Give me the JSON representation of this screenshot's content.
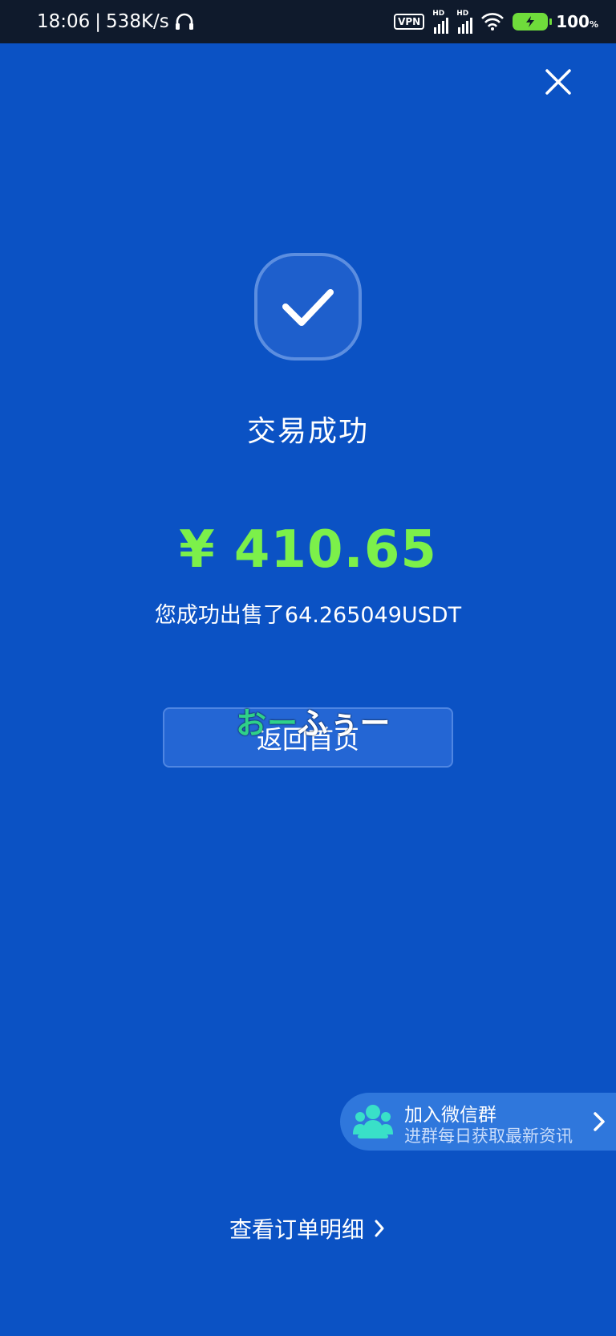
{
  "status_bar": {
    "time": "18:06",
    "separator": "|",
    "speed": "538K/s",
    "vpn": "VPN",
    "hd1": "HD",
    "hd2": "HD",
    "battery_percent": "100",
    "battery_unit": "%"
  },
  "result": {
    "title": "交易成功",
    "amount": "¥ 410.65",
    "description": "您成功出售了64.265049USDT",
    "home_button": "返回首页"
  },
  "overlay_caption": {
    "green_part": "おー",
    "white_part": "ふぅー"
  },
  "wechat_banner": {
    "title": "加入微信群",
    "subtitle": "进群每日获取最新资讯"
  },
  "footer": {
    "order_detail": "查看订单明细"
  },
  "colors": {
    "background": "#0b52c4",
    "amount": "#7cf04a",
    "status_bar": "#0f1a2c",
    "battery": "#6fdc3b",
    "wechat_icon": "#39e0c8"
  },
  "icons": {
    "close": "close-icon",
    "success": "checkmark-icon",
    "wechat": "group-people-icon",
    "chevron": "chevron-right-icon"
  }
}
